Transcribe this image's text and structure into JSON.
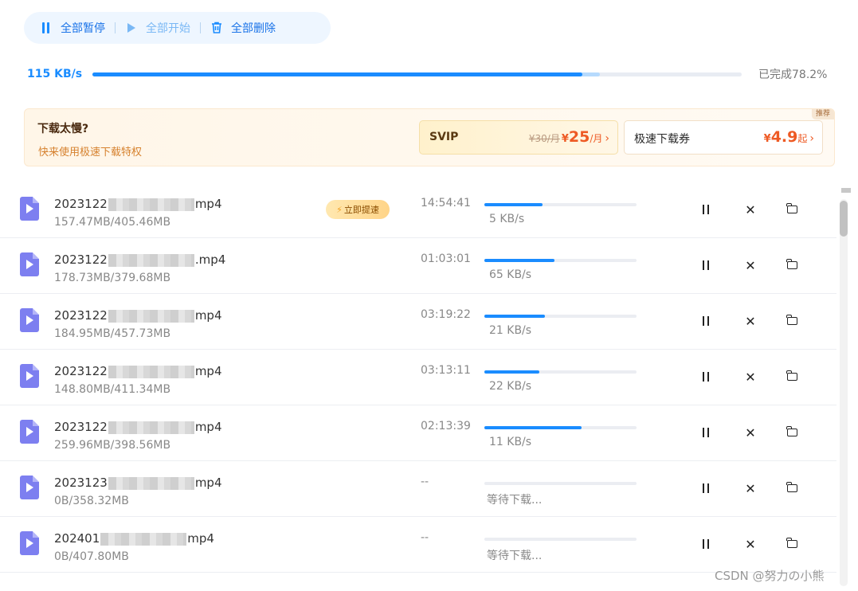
{
  "toolbar": {
    "pause_all": "全部暂停",
    "start_all": "全部开始",
    "delete_all": "全部删除"
  },
  "overall": {
    "speed": "115 KB/s",
    "status": "已完成78.2%",
    "progress": 0.782
  },
  "promo": {
    "title": "下载太慢?",
    "subtitle": "快来使用极速下载特权",
    "tag": "推荐",
    "svip": {
      "name": "SVIP",
      "original_price": "¥30/月",
      "currency": "¥",
      "price": "25",
      "unit": "/月",
      "arrow": "›"
    },
    "voucher": {
      "name": "极速下载券",
      "currency": "¥",
      "price": "4.9",
      "unit": "起",
      "arrow": "›"
    }
  },
  "downloads": [
    {
      "prefix": "2023122",
      "suffix": "mp4",
      "size": "157.47MB/405.46MB",
      "remaining": "14:54:41",
      "progress": 0.38,
      "speed": "5 KB/s",
      "accel": "立即提速"
    },
    {
      "prefix": "2023122",
      "suffix": ".mp4",
      "size": "178.73MB/379.68MB",
      "remaining": "01:03:01",
      "progress": 0.46,
      "speed": "65 KB/s"
    },
    {
      "prefix": "2023122",
      "suffix": "mp4",
      "size": "184.95MB/457.73MB",
      "remaining": "03:19:22",
      "progress": 0.4,
      "speed": "21 KB/s"
    },
    {
      "prefix": "2023122",
      "suffix": "mp4",
      "size": "148.80MB/411.34MB",
      "remaining": "03:13:11",
      "progress": 0.36,
      "speed": "22 KB/s"
    },
    {
      "prefix": "2023122",
      "suffix": "mp4",
      "size": "259.96MB/398.56MB",
      "remaining": "02:13:39",
      "progress": 0.64,
      "speed": "11 KB/s"
    },
    {
      "prefix": "2023123",
      "suffix": "mp4",
      "size": "0B/358.32MB",
      "remaining": "--",
      "progress": 0,
      "speed": "等待下载..."
    },
    {
      "prefix": "202401",
      "suffix": "mp4",
      "size": "0B/407.80MB",
      "remaining": "--",
      "progress": 0,
      "speed": "等待下载..."
    }
  ],
  "watermark": "CSDN @努力の小熊",
  "colors": {
    "accent": "#1a8cff",
    "price": "#ee5a24",
    "file_icon": "#7d7ff0"
  }
}
